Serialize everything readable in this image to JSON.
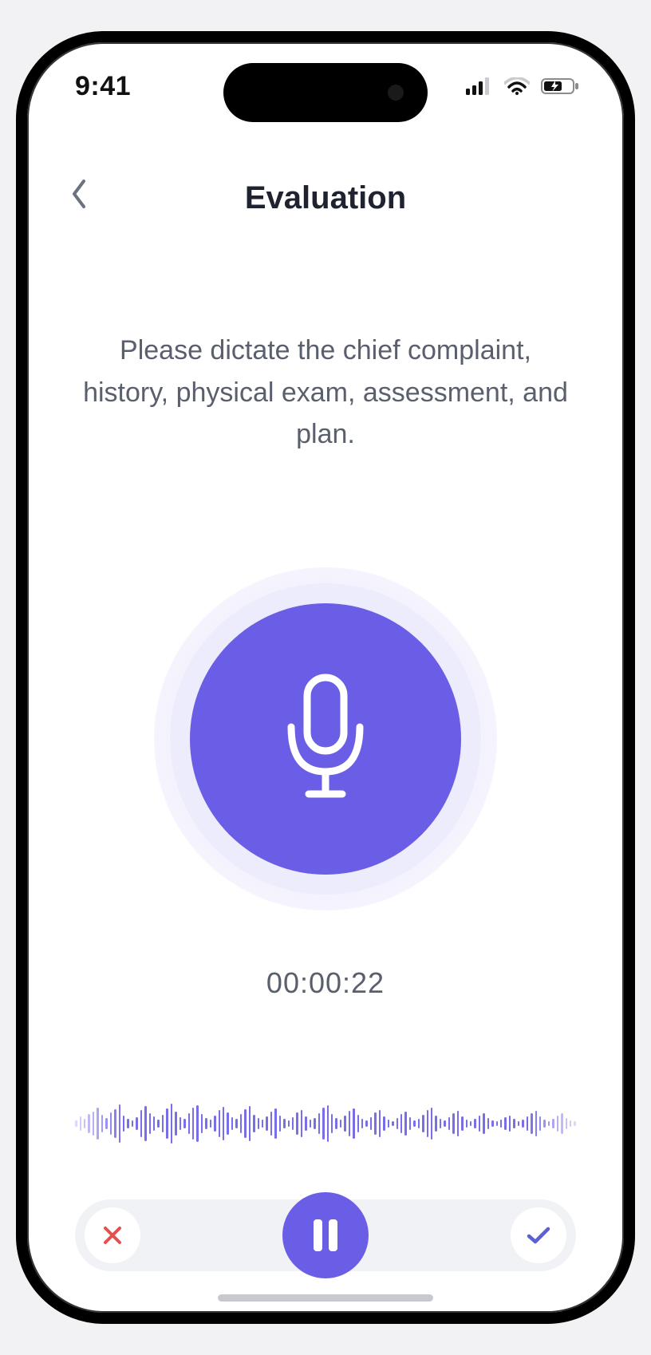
{
  "status": {
    "time": "9:41"
  },
  "header": {
    "title": "Evaluation"
  },
  "instruction": "Please dictate the chief complaint, history, physical exam, assessment, and plan.",
  "recording": {
    "timer": "00:00:22"
  },
  "colors": {
    "accent": "#6a5de6",
    "cancel": "#e4504f",
    "confirm": "#5a61d6"
  },
  "waveform_heights": [
    8,
    18,
    12,
    24,
    30,
    40,
    22,
    14,
    28,
    36,
    48,
    20,
    12,
    8,
    16,
    34,
    44,
    26,
    18,
    10,
    22,
    38,
    50,
    30,
    16,
    12,
    26,
    40,
    46,
    24,
    14,
    10,
    20,
    34,
    42,
    28,
    16,
    12,
    24,
    36,
    44,
    22,
    14,
    10,
    18,
    30,
    38,
    20,
    12,
    8,
    16,
    28,
    34,
    18,
    10,
    14,
    26,
    40,
    46,
    24,
    14,
    10,
    20,
    32,
    38,
    22,
    12,
    8,
    16,
    28,
    34,
    18,
    10,
    6,
    14,
    24,
    30,
    16,
    8,
    12,
    22,
    34,
    40,
    20,
    12,
    8,
    16,
    26,
    32,
    18,
    10,
    6,
    12,
    20,
    26,
    14,
    8,
    6,
    10,
    16,
    20,
    12,
    6,
    10,
    18,
    26,
    32,
    18,
    10,
    6,
    12,
    20,
    26,
    14,
    8,
    6
  ]
}
